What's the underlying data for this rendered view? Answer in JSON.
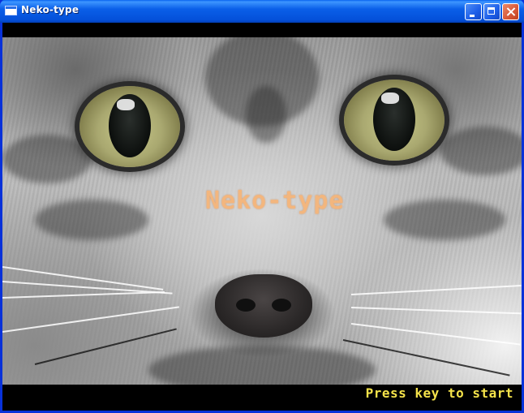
{
  "window": {
    "title": "Neko-type",
    "icon": "application-icon",
    "controls": {
      "minimize": "minimize-icon",
      "maximize": "maximize-icon",
      "close": "close-icon"
    }
  },
  "game": {
    "title": "Neko-type",
    "start_prompt": "Press key to start",
    "background": "cat-face-photo",
    "colors": {
      "title": "#f5b57a",
      "prompt": "#f4e24a",
      "letterbox": "#000000"
    }
  }
}
